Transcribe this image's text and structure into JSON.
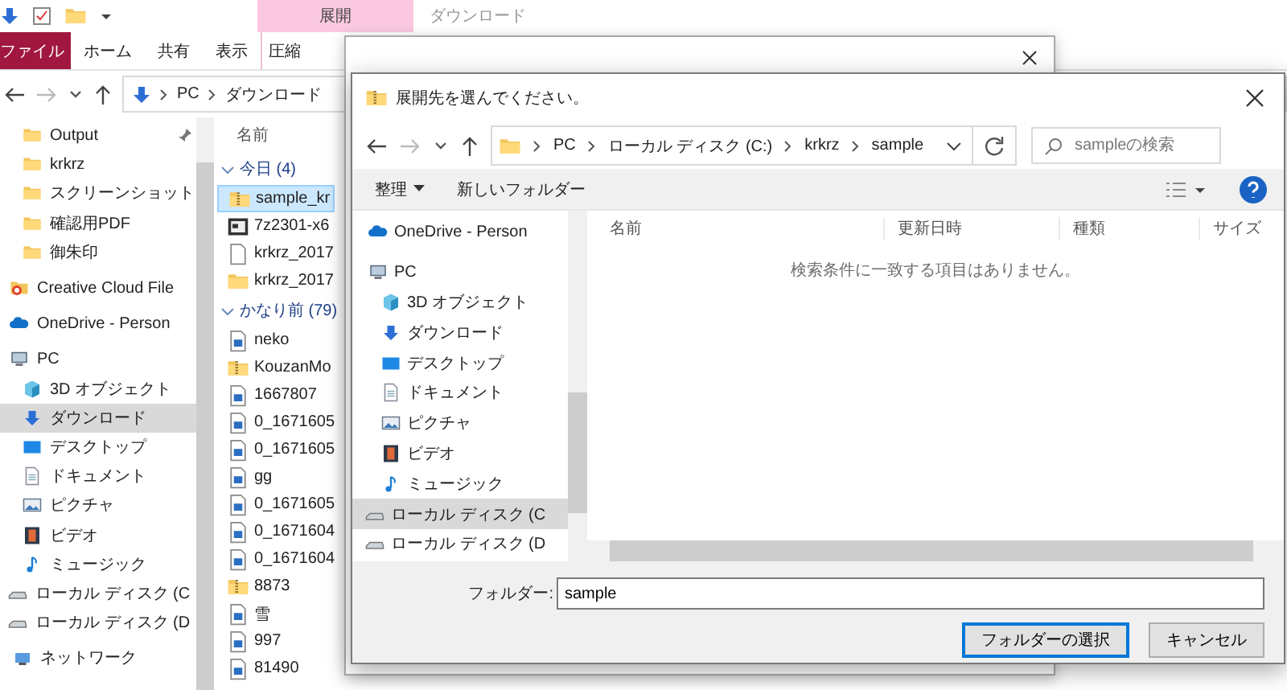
{
  "explorer": {
    "contextual_tab": "展開",
    "title": "ダウンロード",
    "ribbon_tabs": [
      {
        "label": "ファイル",
        "kind": "file"
      },
      {
        "label": "ホーム",
        "kind": "tab"
      },
      {
        "label": "共有",
        "kind": "tab"
      },
      {
        "label": "表示",
        "kind": "tab"
      },
      {
        "label": "圧縮",
        "kind": "contextual"
      }
    ],
    "address": {
      "path": [
        "PC",
        "ダウンロード"
      ]
    },
    "nav_groups": [
      {
        "items": [
          {
            "label": "Output",
            "kind": "folder",
            "pinned": true,
            "selected": false
          },
          {
            "label": "krkrz",
            "kind": "folder",
            "pinned": false,
            "selected": false
          },
          {
            "label": "スクリーンショット",
            "kind": "folder",
            "pinned": false,
            "selected": false
          },
          {
            "label": "確認用PDF",
            "kind": "folder",
            "pinned": false,
            "selected": false
          },
          {
            "label": "御朱印",
            "kind": "folder",
            "pinned": false,
            "selected": false
          }
        ]
      },
      {
        "items": [
          {
            "label": "Creative Cloud File",
            "kind": "cc",
            "pinned": false,
            "selected": false
          }
        ]
      },
      {
        "items": [
          {
            "label": "OneDrive - Person",
            "kind": "cloud",
            "pinned": false,
            "selected": false
          }
        ]
      },
      {
        "items": [
          {
            "label": "PC",
            "kind": "pc",
            "pinned": false,
            "selected": false
          },
          {
            "label": "3D オブジェクト",
            "kind": "cube",
            "pinned": false,
            "selected": false
          },
          {
            "label": "ダウンロード",
            "kind": "download",
            "pinned": false,
            "selected": true
          },
          {
            "label": "デスクトップ",
            "kind": "desktop",
            "pinned": false,
            "selected": false
          },
          {
            "label": "ドキュメント",
            "kind": "doc",
            "pinned": false,
            "selected": false
          },
          {
            "label": "ピクチャ",
            "kind": "picture",
            "pinned": false,
            "selected": false
          },
          {
            "label": "ビデオ",
            "kind": "video",
            "pinned": false,
            "selected": false
          },
          {
            "label": "ミュージック",
            "kind": "music",
            "pinned": false,
            "selected": false
          },
          {
            "label": "ローカル ディスク (C",
            "kind": "drive",
            "pinned": false,
            "selected": false
          },
          {
            "label": "ローカル ディスク (D",
            "kind": "drive",
            "pinned": false,
            "selected": false
          }
        ]
      },
      {
        "items": [
          {
            "label": "ネットワーク",
            "kind": "network",
            "pinned": false,
            "selected": false
          }
        ]
      }
    ],
    "files": {
      "column": "名前",
      "groups": [
        {
          "label": "今日 (4)",
          "expanded": true,
          "items": [
            {
              "name": "sample_kr",
              "kind": "zip",
              "selected": true
            },
            {
              "name": "7z2301-x6",
              "kind": "app",
              "selected": false
            },
            {
              "name": "krkrz_2017",
              "kind": "file",
              "selected": false
            },
            {
              "name": "krkrz_2017",
              "kind": "folder",
              "selected": false
            }
          ]
        },
        {
          "label": "かなり前 (79)",
          "expanded": true,
          "items": [
            {
              "name": "neko",
              "kind": "image",
              "selected": false
            },
            {
              "name": "KouzanMo",
              "kind": "zip",
              "selected": false
            },
            {
              "name": "1667807",
              "kind": "image",
              "selected": false
            },
            {
              "name": "0_1671605",
              "kind": "image",
              "selected": false
            },
            {
              "name": "0_1671605",
              "kind": "image",
              "selected": false
            },
            {
              "name": "gg",
              "kind": "image",
              "selected": false
            },
            {
              "name": "0_1671605",
              "kind": "image",
              "selected": false
            },
            {
              "name": "0_1671604",
              "kind": "image",
              "selected": false
            },
            {
              "name": "0_1671604",
              "kind": "image",
              "selected": false
            },
            {
              "name": "8873",
              "kind": "zip",
              "selected": false
            },
            {
              "name": "雪",
              "kind": "image",
              "selected": false
            },
            {
              "name": "997",
              "kind": "image",
              "selected": false
            },
            {
              "name": "81490",
              "kind": "image",
              "selected": false
            }
          ]
        }
      ]
    }
  },
  "dialog": {
    "title": "展開先を選んでください。",
    "address": {
      "path": [
        "PC",
        "ローカル ディスク (C:)",
        "krkrz",
        "sample"
      ]
    },
    "search": {
      "placeholder": "sampleの検索"
    },
    "toolbar": [
      {
        "label": "整理",
        "kind": "menu"
      },
      {
        "label": "新しいフォルダー",
        "kind": "button"
      }
    ],
    "nav_groups": [
      {
        "items": [
          {
            "label": "OneDrive - Person",
            "kind": "cloud",
            "selected": false
          }
        ]
      },
      {
        "items": [
          {
            "label": "PC",
            "kind": "pc",
            "selected": false
          },
          {
            "label": "3D オブジェクト",
            "kind": "cube",
            "selected": false
          },
          {
            "label": "ダウンロード",
            "kind": "download",
            "selected": false
          },
          {
            "label": "デスクトップ",
            "kind": "desktop",
            "selected": false
          },
          {
            "label": "ドキュメント",
            "kind": "doc",
            "selected": false
          },
          {
            "label": "ピクチャ",
            "kind": "picture",
            "selected": false
          },
          {
            "label": "ビデオ",
            "kind": "video",
            "selected": false
          },
          {
            "label": "ミュージック",
            "kind": "music",
            "selected": false
          },
          {
            "label": "ローカル ディスク (C",
            "kind": "drive",
            "selected": true
          },
          {
            "label": "ローカル ディスク (D",
            "kind": "drive",
            "selected": false
          }
        ]
      }
    ],
    "columns": [
      "名前",
      "更新日時",
      "種類",
      "サイズ"
    ],
    "empty_message": "検索条件に一致する項目はありません。",
    "folder_field": {
      "label": "フォルダー:",
      "value": "sample"
    },
    "buttons": [
      {
        "label": "フォルダーの選択",
        "default": true
      },
      {
        "label": "キャンセル",
        "default": false
      }
    ]
  }
}
